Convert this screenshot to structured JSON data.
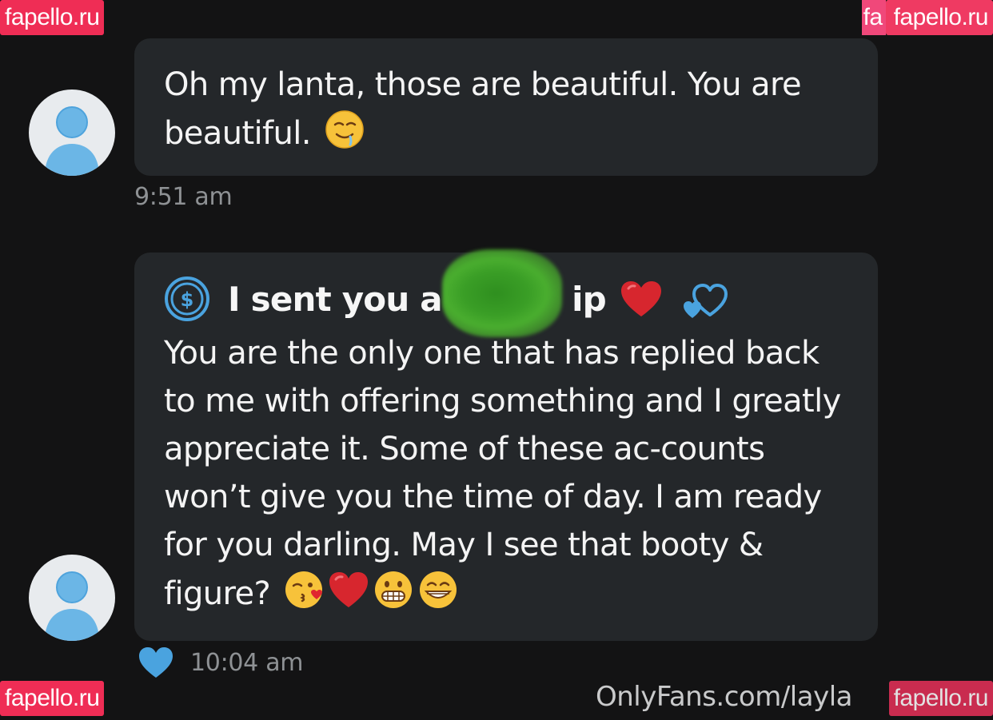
{
  "watermarks": {
    "top_left": "fapello.ru",
    "top_right": "fapello.ru",
    "top_right_fragment": "fa",
    "bottom_left": "fapello.ru",
    "bottom_right": "fapello.ru"
  },
  "messages": [
    {
      "text": "Oh my lanta, those are beautiful. You are beautiful.",
      "emojis": [
        "drooling-face-emoji"
      ],
      "time": "9:51 am"
    },
    {
      "tip_text_prefix": "I sent you a $",
      "tip_text_suffix": "ip",
      "tip_icons": [
        "dollar-circle-icon",
        "red-heart-emoji",
        "blue-hearts-icon"
      ],
      "text": "You are the only one that has replied back to me with offering something and I greatly appreciate it. Some of these ac-counts won’t give you the time of day. I am ready for you darling. May I see that booty & figure?",
      "emojis": [
        "kissing-heart-emoji",
        "red-heart-emoji",
        "grimacing-emoji",
        "grinning-emoji"
      ],
      "time": "10:04 am",
      "liked": true
    }
  ],
  "footer": {
    "credit": "OnlyFans.com/layla"
  },
  "colors": {
    "background": "#131314",
    "bubble": "#24272a",
    "accent_blue": "#4aa3df",
    "timestamp": "#8e9194",
    "watermark": "#ef2d55"
  }
}
